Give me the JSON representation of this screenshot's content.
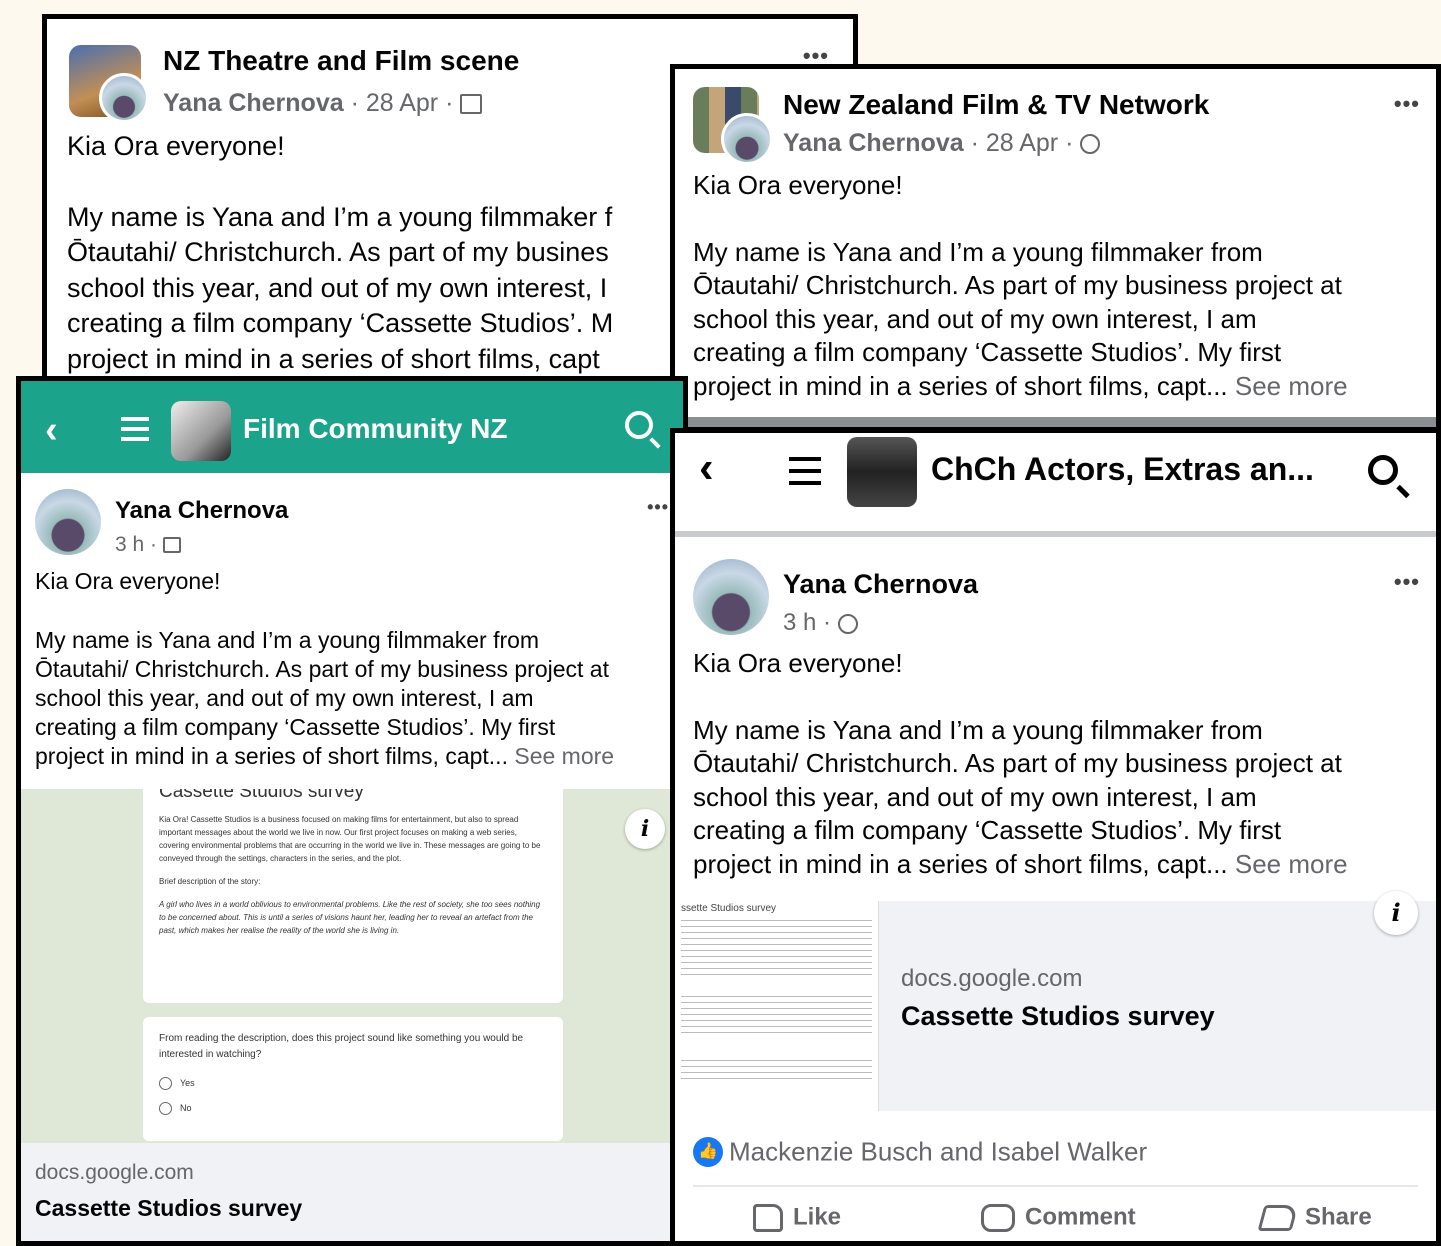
{
  "post1": {
    "group": "NZ Theatre and Film scene",
    "author": "Yana Chernova",
    "meta": " · 28 Apr · ",
    "greeting": "Kia Ora everyone!",
    "body": "My name is Yana and I’m a young filmmaker f\nŌtautahi/ Christchurch. As part of my busines\nschool this year, and out of my own interest, I\ncreating a film company ‘Cassette Studios’. M\nproject in mind in a series of short films, capt",
    "menu": "•••",
    "privacy_icon": "group-privacy-icon"
  },
  "post2": {
    "group": "New Zealand Film & TV Network",
    "author": "Yana Chernova",
    "meta": " · 28 Apr · ",
    "greeting": "Kia Ora everyone!",
    "body": "My name is Yana and I’m a young filmmaker from\nŌtautahi/ Christchurch. As part of my business project at\nschool this year, and out of my own interest, I am\ncreating a film company ‘Cassette Studios’. My first\nproject in mind in a series of short films, capt... ",
    "see_more": "See more",
    "menu": "•••",
    "privacy_icon": "globe-icon"
  },
  "post3": {
    "header_title": "Film Community NZ",
    "header_color": "#1ba38b",
    "author": "Yana Chernova",
    "meta": "3 h · ",
    "greeting": "Kia Ora everyone!",
    "body": "My name is Yana and I’m a young filmmaker from\nŌtautahi/ Christchurch. As part of my business project at\nschool this year, and out of my own interest, I am\ncreating a film company ‘Cassette Studios’. My first\nproject in mind in a series of short films, capt... ",
    "see_more": "See more",
    "menu": "•••",
    "survey": {
      "title": "Cassette Studios survey",
      "intro": "Kia Ora! Cassette Studios is a business focused on making films for entertainment, but also to spread important messages about the world we live in now. Our first project focuses on making a web series, covering environmental problems that are occurring in the world we live in. These messages are going to be conveyed through the settings, characters in the series, and the plot.",
      "brief_label": "Brief description of the story:",
      "brief": "A girl who lives in a world oblivious to environmental problems. Like the rest of society, she too sees nothing to be concerned about. This is until a series of visions haunt her, leading her to reveal an artefact from the past, which makes her realise the reality of the world she is living in.",
      "question": "From reading the description, does this project sound like something you would be interested in watching?",
      "options": [
        "Yes",
        "No"
      ]
    },
    "link_domain": "docs.google.com",
    "link_title": "Cassette Studios survey"
  },
  "post4": {
    "header_title": "ChCh Actors, Extras an...",
    "author": "Yana Chernova",
    "meta": "3 h · ",
    "greeting": "Kia Ora everyone!",
    "body": "My name is Yana and I’m a young filmmaker from\nŌtautahi/ Christchurch. As part of my business project at\nschool this year, and out of my own interest, I am\ncreating a film company ‘Cassette Studios’. My first\nproject in mind in a series of short films, capt... ",
    "see_more": "See more",
    "menu": "•••",
    "thumb_title": "ssette Studios survey",
    "link_domain": "docs.google.com",
    "link_title": "Cassette Studios survey",
    "reactions": "Mackenzie Busch and Isabel Walker",
    "actions": {
      "like": "Like",
      "comment": "Comment",
      "share": "Share"
    }
  }
}
